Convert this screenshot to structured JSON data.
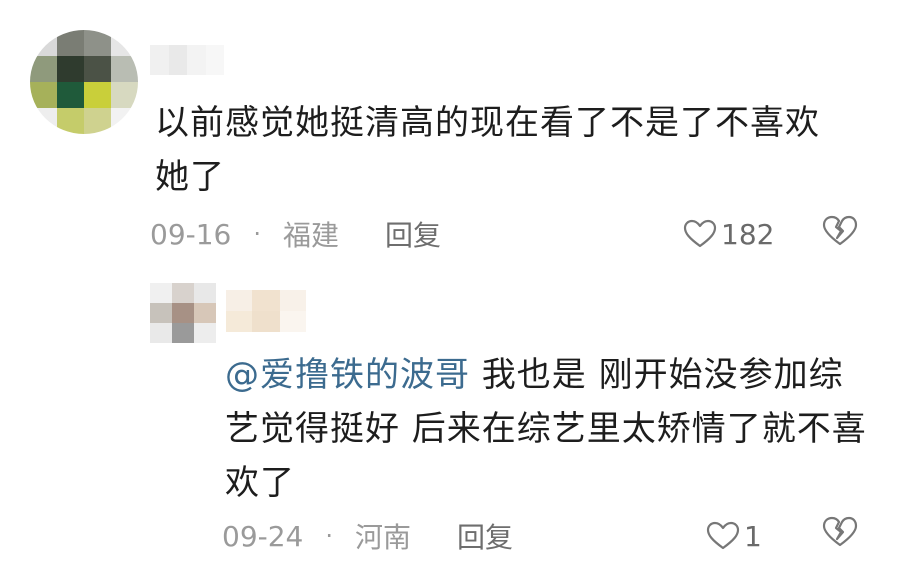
{
  "comments": [
    {
      "text": "以前感觉她挺清高的现在看了不是了不喜欢她了",
      "date": "09-16",
      "separator": "·",
      "location": "福建",
      "reply_label": "回复",
      "like_count": "182"
    }
  ],
  "replies": [
    {
      "mention": "@爱撸铁的波哥",
      "text": " 我也是 刚开始没参加综艺觉得挺好 后来在综艺里太矫情了就不喜欢了",
      "date": "09-24",
      "separator": "·",
      "location": "河南",
      "reply_label": "回复",
      "like_count": "1"
    }
  ],
  "icons": {
    "like": "heart-outline-icon",
    "dislike": "broken-heart-icon"
  },
  "colors": {
    "mention": "#3c6b8f",
    "meta": "#9a9a9a",
    "text": "#1d1d1d"
  }
}
